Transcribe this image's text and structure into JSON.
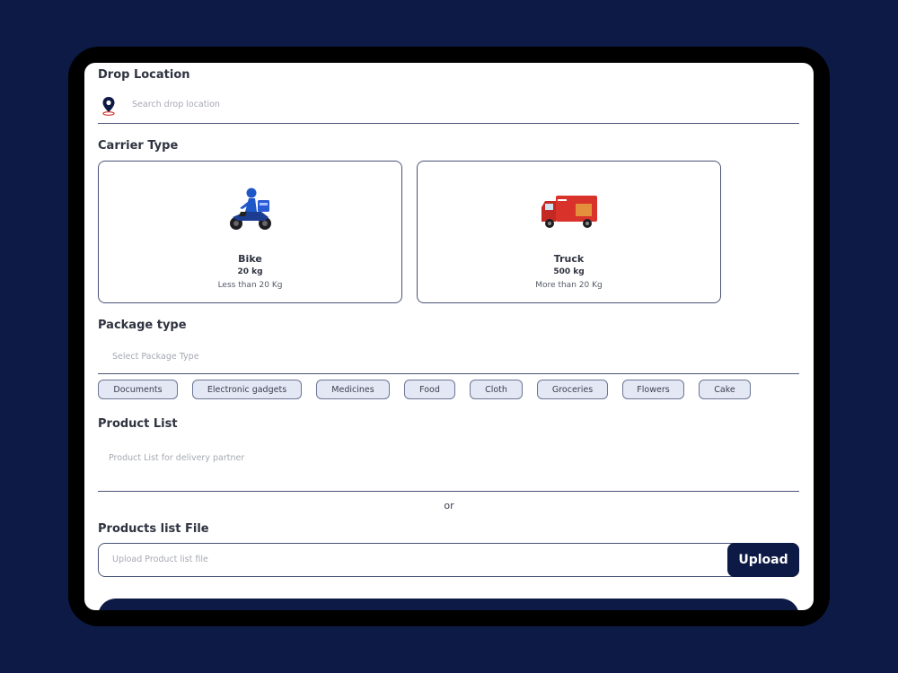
{
  "drop_location": {
    "label": "Drop Location",
    "placeholder": "Search drop location",
    "icon": "location-pin-icon"
  },
  "carrier_type": {
    "label": "Carrier Type",
    "options": [
      {
        "title": "Bike",
        "weight": "20 kg",
        "desc": "Less than 20 Kg",
        "icon": "bike-rider-icon"
      },
      {
        "title": "Truck",
        "weight": "500 kg",
        "desc": "More than 20 Kg",
        "icon": "truck-icon"
      }
    ]
  },
  "package_type": {
    "label": "Package type",
    "placeholder": "Select Package Type",
    "chips": [
      "Documents",
      "Electronic gadgets",
      "Medicines",
      "Food",
      "Cloth",
      "Groceries",
      "Flowers",
      "Cake"
    ]
  },
  "product_list": {
    "label": "Product List",
    "placeholder": "Product List for delivery partner"
  },
  "or_text": "or",
  "products_file": {
    "label": "Products list File",
    "placeholder": "Upload Product list file",
    "button": "Upload"
  },
  "colors": {
    "brand": "#0d1a45",
    "chip_bg": "#e4e8f5",
    "pin": "#0d1a45",
    "truck": "#d8322a"
  }
}
